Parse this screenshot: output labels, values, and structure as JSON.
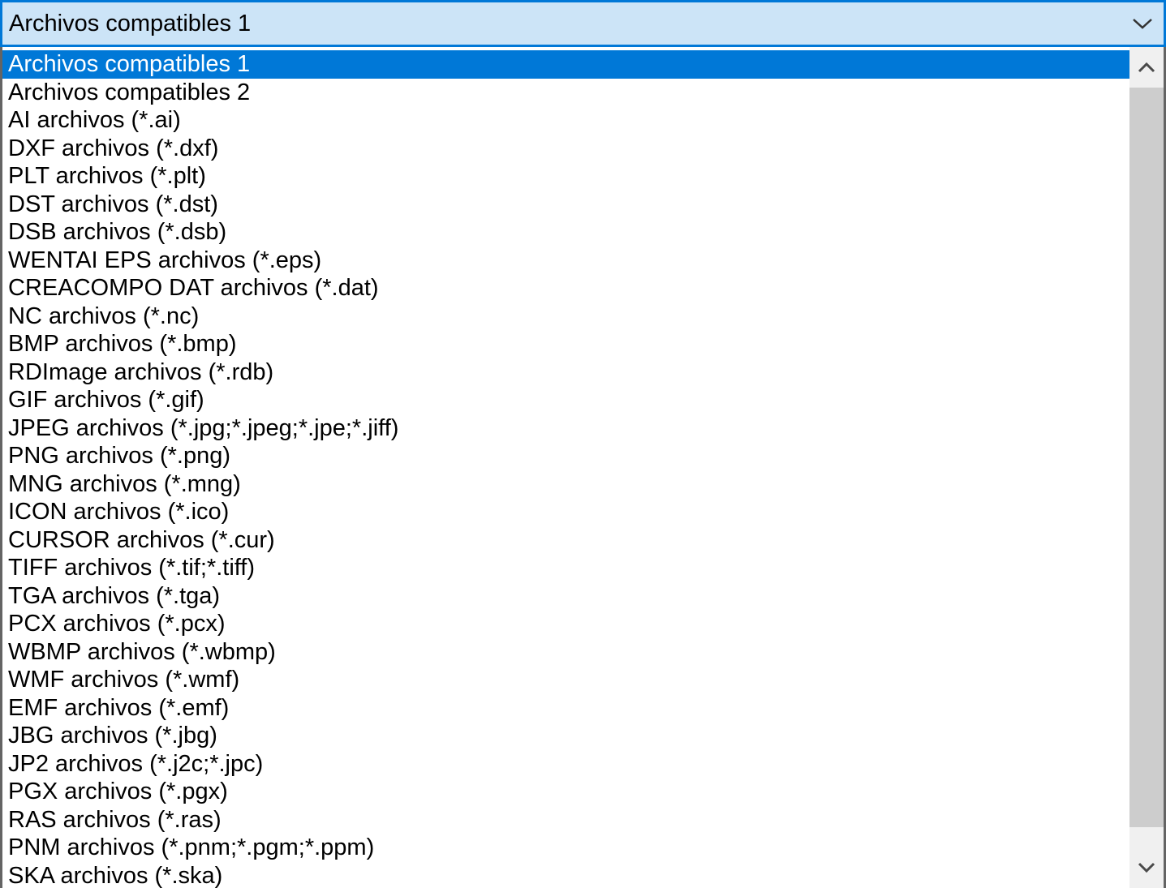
{
  "combo": {
    "selected_value": "Archivos compatibles 1",
    "arrow_icon": "chevron-down-icon"
  },
  "dropdown": {
    "selected_index": 0,
    "options": [
      "Archivos compatibles 1",
      "Archivos compatibles 2",
      "AI archivos (*.ai)",
      "DXF archivos (*.dxf)",
      "PLT archivos (*.plt)",
      "DST archivos (*.dst)",
      "DSB archivos (*.dsb)",
      "WENTAI EPS archivos (*.eps)",
      "CREACOMPO DAT archivos (*.dat)",
      "NC archivos (*.nc)",
      "BMP archivos (*.bmp)",
      "RDImage archivos (*.rdb)",
      "GIF archivos (*.gif)",
      "JPEG archivos (*.jpg;*.jpeg;*.jpe;*.jiff)",
      "PNG archivos (*.png)",
      "MNG archivos (*.mng)",
      "ICON archivos (*.ico)",
      "CURSOR archivos (*.cur)",
      "TIFF archivos (*.tif;*.tiff)",
      "TGA archivos (*.tga)",
      "PCX archivos (*.pcx)",
      "WBMP archivos (*.wbmp)",
      "WMF archivos (*.wmf)",
      "EMF archivos (*.emf)",
      "JBG archivos (*.jbg)",
      "JP2 archivos (*.j2c;*.jpc)",
      "PGX archivos (*.pgx)",
      "RAS archivos (*.ras)",
      "PNM archivos (*.pnm;*.pgm;*.ppm)",
      "SKA archivos (*.ska)"
    ]
  },
  "scrollbar": {
    "up_icon": "chevron-up-icon",
    "down_icon": "chevron-down-icon"
  },
  "colors": {
    "accent": "#0078d7",
    "combo_background": "#cce4f7",
    "scroll_track": "#f0f0f0",
    "scroll_thumb": "#cdcdcd"
  }
}
